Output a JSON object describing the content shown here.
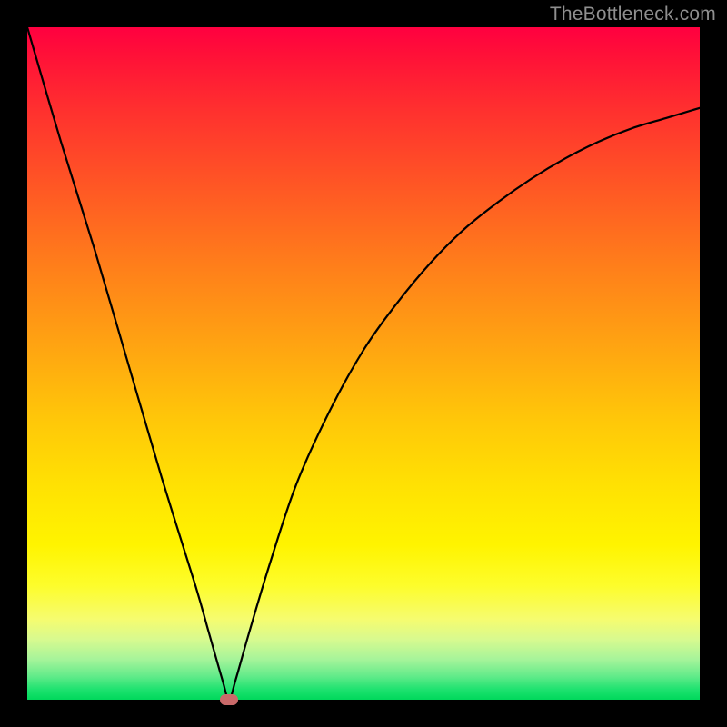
{
  "watermark": "TheBottleneck.com",
  "chart_data": {
    "type": "line",
    "title": "",
    "xlabel": "",
    "ylabel": "",
    "xlim": [
      0,
      100
    ],
    "ylim": [
      0,
      100
    ],
    "series": [
      {
        "name": "bottleneck-curve",
        "x": [
          0,
          5,
          10,
          15,
          20,
          25,
          27,
          29,
          30,
          31,
          33,
          36,
          40,
          45,
          50,
          55,
          60,
          65,
          70,
          75,
          80,
          85,
          90,
          95,
          100
        ],
        "values": [
          100,
          83,
          67,
          50,
          33,
          17,
          10,
          3,
          0,
          3,
          10,
          20,
          32,
          43,
          52,
          59,
          65,
          70,
          74,
          77.5,
          80.5,
          83,
          85,
          86.5,
          88
        ]
      }
    ],
    "minimum_marker": {
      "x": 30,
      "y": 0
    },
    "background_gradient": {
      "top": "#ff0040",
      "bottom": "#00d85b"
    }
  }
}
